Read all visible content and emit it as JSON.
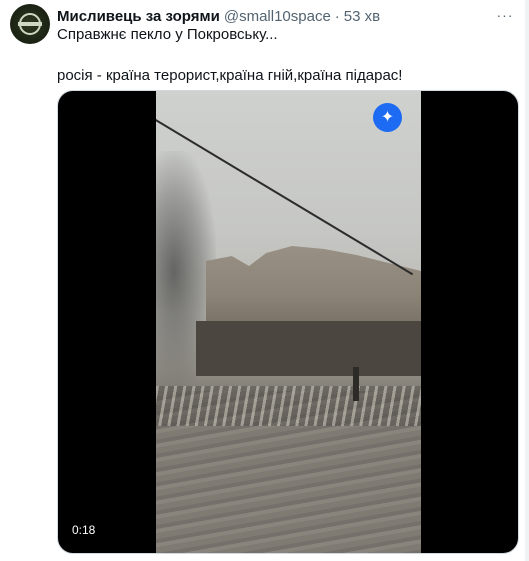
{
  "tweet": {
    "author_name": "Мисливець за зорями",
    "handle": "@small10space",
    "separator": "·",
    "time": "53 хв",
    "more_label": "···",
    "text_line1": "Справжнє пекло у Покровську...",
    "text_line2": "росія - країна терорист,країна гній,країна підарас!"
  },
  "media": {
    "duration": "0:18",
    "overlay_icon": "grok-sparkle-icon",
    "overlay_glyph": "✦"
  },
  "colors": {
    "accent": "#1d6bf3",
    "text": "#0f1419",
    "secondary": "#536471"
  }
}
